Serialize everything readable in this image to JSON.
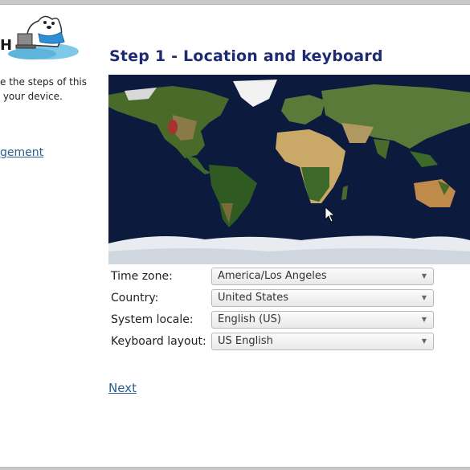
{
  "sidebar": {
    "intro_text": "e the steps of this\n your device.",
    "link_label": "gement"
  },
  "logo": {
    "icon": "polar-bear-logo-icon",
    "text": "H"
  },
  "main": {
    "title": "Step 1 - Location and keyboard",
    "map_icon": "world-map",
    "next_label": "Next"
  },
  "form": {
    "timezone": {
      "label": "Time zone:",
      "value": "America/Los Angeles"
    },
    "country": {
      "label": "Country:",
      "value": "United States"
    },
    "locale": {
      "label": "System locale:",
      "value": "English (US)"
    },
    "keyboard": {
      "label": "Keyboard layout:",
      "value": "US English"
    }
  },
  "colors": {
    "title": "#1e2a72",
    "link": "#2b5d8e",
    "ocean": "#0c1a3e",
    "timezone_marker": "#a83232"
  }
}
